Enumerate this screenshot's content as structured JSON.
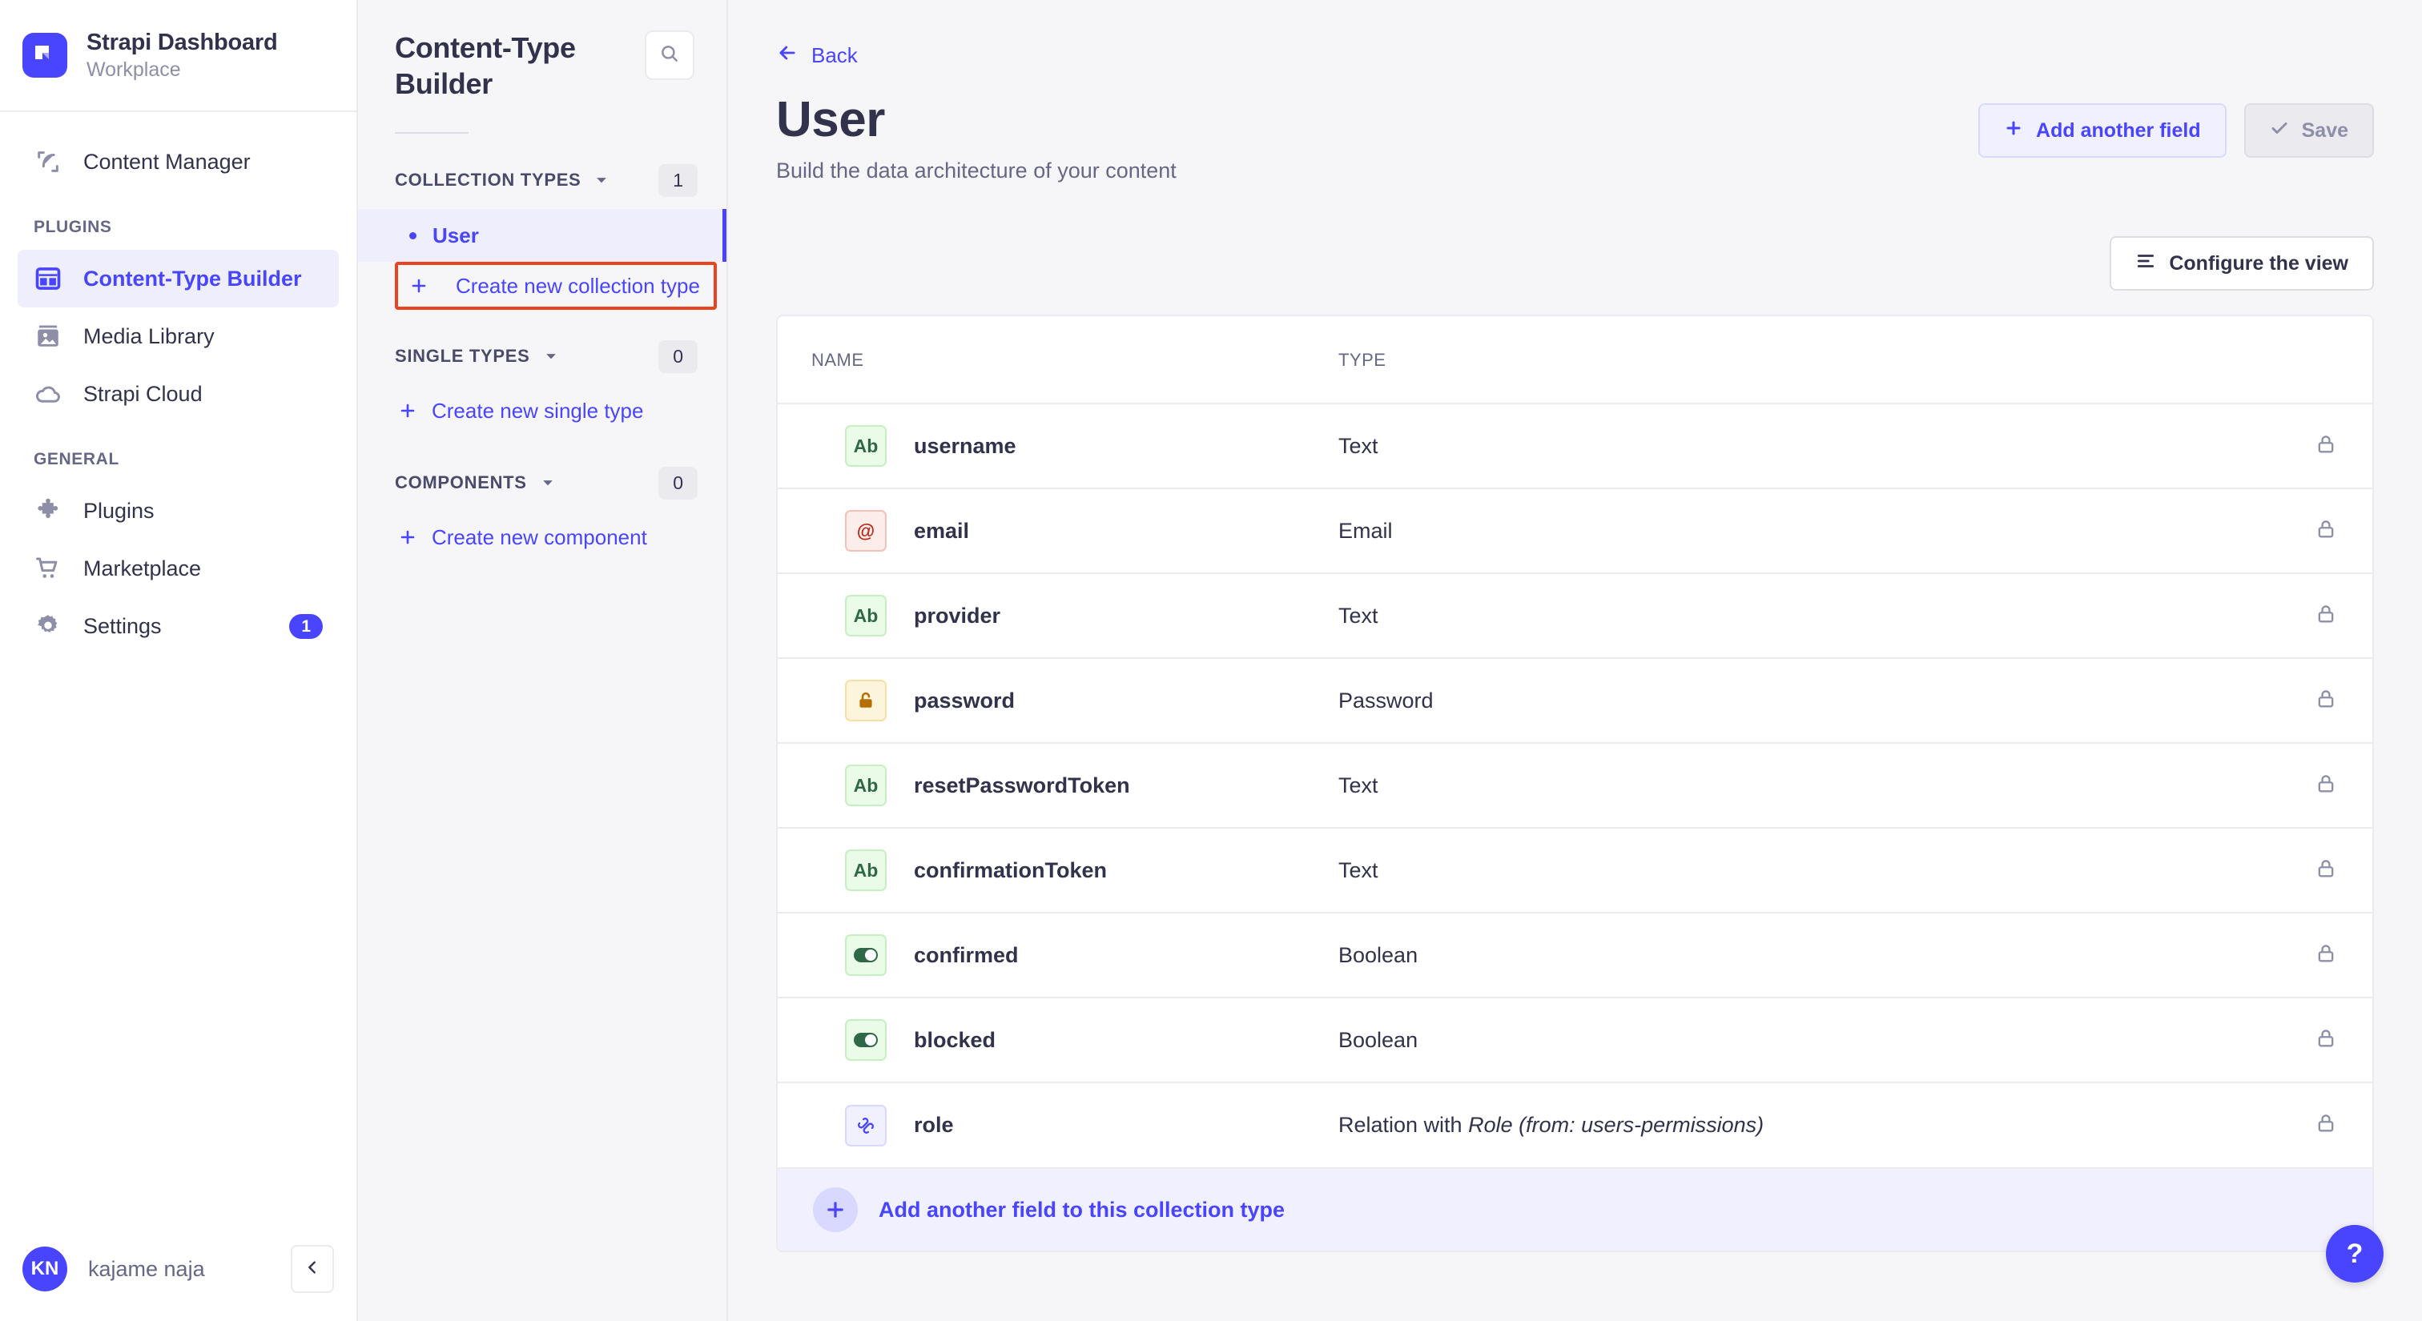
{
  "brand": {
    "title": "Strapi Dashboard",
    "subtitle": "Workplace",
    "logo_color": "#4945ff"
  },
  "sidebar": {
    "items": [
      {
        "label": "Content Manager",
        "icon": "feather-icon",
        "active": false
      }
    ],
    "groups": [
      {
        "title": "PLUGINS",
        "items": [
          {
            "label": "Content-Type Builder",
            "icon": "layout-icon",
            "active": true
          },
          {
            "label": "Media Library",
            "icon": "image-icon",
            "active": false
          },
          {
            "label": "Strapi Cloud",
            "icon": "cloud-icon",
            "active": false
          }
        ]
      },
      {
        "title": "GENERAL",
        "items": [
          {
            "label": "Plugins",
            "icon": "puzzle-icon",
            "active": false
          },
          {
            "label": "Marketplace",
            "icon": "shopping-cart-icon",
            "active": false
          },
          {
            "label": "Settings",
            "icon": "gear-icon",
            "active": false,
            "badge": "1"
          }
        ]
      }
    ],
    "footer": {
      "avatar_initials": "KN",
      "user_name": "kajame naja",
      "collapse_icon": "chevron-left-icon"
    }
  },
  "ctb_panel": {
    "title": "Content-Type Builder",
    "search_icon": "search-icon",
    "sections": [
      {
        "label": "COLLECTION TYPES",
        "count": "1"
      },
      {
        "label": "SINGLE TYPES",
        "count": "0"
      },
      {
        "label": "COMPONENTS",
        "count": "0"
      }
    ],
    "collection_types": [
      {
        "label": "User",
        "selected": true
      }
    ],
    "create_collection_label": "Create new collection type",
    "create_single_label": "Create new single type",
    "create_component_label": "Create new component",
    "highlight_color": "#e8441f"
  },
  "main": {
    "back_label": "Back",
    "title": "User",
    "subtitle": "Build the data architecture of your content",
    "add_field_button": "Add another field",
    "save_button": "Save",
    "configure_view_button": "Configure the view",
    "table": {
      "headers": {
        "name": "NAME",
        "type": "TYPE"
      },
      "rows": [
        {
          "name": "username",
          "type": "Text",
          "icon": "text-icon",
          "icon_glyph": "Ab",
          "icon_class": "ti-text"
        },
        {
          "name": "email",
          "type": "Email",
          "icon": "email-icon",
          "icon_glyph": "@",
          "icon_class": "ti-email"
        },
        {
          "name": "provider",
          "type": "Text",
          "icon": "text-icon",
          "icon_glyph": "Ab",
          "icon_class": "ti-text"
        },
        {
          "name": "password",
          "type": "Password",
          "icon": "lock-icon",
          "icon_glyph": "",
          "icon_class": "ti-password"
        },
        {
          "name": "resetPasswordToken",
          "type": "Text",
          "icon": "text-icon",
          "icon_glyph": "Ab",
          "icon_class": "ti-text"
        },
        {
          "name": "confirmationToken",
          "type": "Text",
          "icon": "text-icon",
          "icon_glyph": "Ab",
          "icon_class": "ti-text"
        },
        {
          "name": "confirmed",
          "type": "Boolean",
          "icon": "toggle-icon",
          "icon_glyph": "",
          "icon_class": "ti-boolean"
        },
        {
          "name": "blocked",
          "type": "Boolean",
          "icon": "toggle-icon",
          "icon_glyph": "",
          "icon_class": "ti-boolean"
        },
        {
          "name": "role",
          "type": "Relation with Role (from: users-permissions)",
          "type_prefix": "Relation with ",
          "type_italic": "Role (from: users-permissions)",
          "icon": "relation-link-icon",
          "icon_glyph": "",
          "icon_class": "ti-relation"
        }
      ],
      "row_lock_icon": "lock-icon"
    },
    "footer_add_field": "Add another field to this collection type",
    "help_button": "?"
  }
}
